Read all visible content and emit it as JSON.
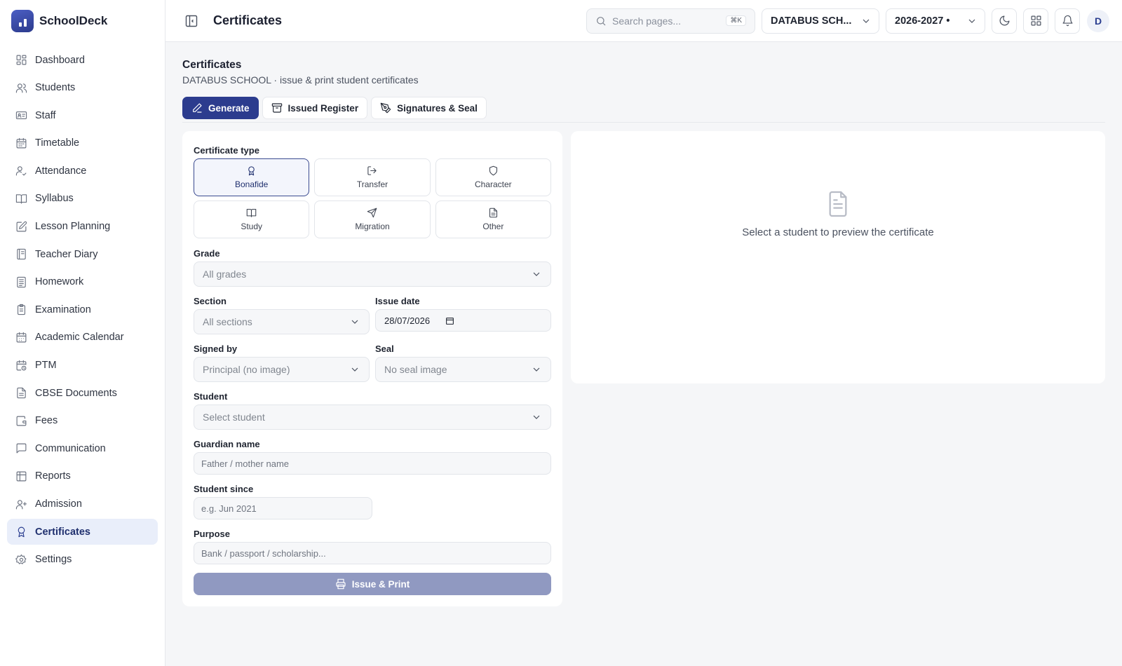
{
  "app": {
    "name": "SchoolDeck"
  },
  "sidebar": {
    "items": [
      {
        "label": "Dashboard",
        "icon": "dashboard-icon"
      },
      {
        "label": "Students",
        "icon": "users-icon"
      },
      {
        "label": "Staff",
        "icon": "id-card-icon"
      },
      {
        "label": "Timetable",
        "icon": "calendar-icon"
      },
      {
        "label": "Attendance",
        "icon": "user-check-icon"
      },
      {
        "label": "Syllabus",
        "icon": "book-open-icon"
      },
      {
        "label": "Lesson Planning",
        "icon": "edit-icon"
      },
      {
        "label": "Teacher Diary",
        "icon": "notebook-icon"
      },
      {
        "label": "Homework",
        "icon": "file-list-icon"
      },
      {
        "label": "Examination",
        "icon": "clipboard-icon"
      },
      {
        "label": "Academic Calendar",
        "icon": "calendar-days-icon"
      },
      {
        "label": "PTM",
        "icon": "calendar-clock-icon"
      },
      {
        "label": "CBSE Documents",
        "icon": "document-icon"
      },
      {
        "label": "Fees",
        "icon": "wallet-icon"
      },
      {
        "label": "Communication",
        "icon": "message-icon"
      },
      {
        "label": "Reports",
        "icon": "table-icon"
      },
      {
        "label": "Admission",
        "icon": "user-plus-icon"
      },
      {
        "label": "Certificates",
        "icon": "award-icon",
        "active": true
      },
      {
        "label": "Settings",
        "icon": "gear-icon"
      }
    ]
  },
  "header": {
    "title": "Certificates",
    "search_placeholder": "Search pages...",
    "search_shortcut": "⌘K",
    "school_select": "DATABUS SCH...",
    "year_select": "2026-2027 •",
    "avatar_initial": "D"
  },
  "page": {
    "title": "Certificates",
    "subtitle": "DATABUS SCHOOL · issue & print student certificates",
    "tabs": [
      {
        "label": "Generate",
        "active": true
      },
      {
        "label": "Issued Register"
      },
      {
        "label": "Signatures & Seal"
      }
    ]
  },
  "form": {
    "type_label": "Certificate type",
    "types": [
      {
        "label": "Bonafide",
        "active": true
      },
      {
        "label": "Transfer"
      },
      {
        "label": "Character"
      },
      {
        "label": "Study"
      },
      {
        "label": "Migration"
      },
      {
        "label": "Other"
      }
    ],
    "grade_label": "Grade",
    "grade_value": "All grades",
    "section_label": "Section",
    "section_value": "All sections",
    "issue_date_label": "Issue date",
    "issue_date_value": "28/07/2026",
    "signed_by_label": "Signed by",
    "signed_by_value": "Principal (no image)",
    "seal_label": "Seal",
    "seal_value": "No seal image",
    "student_label": "Student",
    "student_value": "Select student",
    "guardian_label": "Guardian name",
    "guardian_placeholder": "Father / mother name",
    "since_label": "Student since",
    "since_placeholder": "e.g. Jun 2021",
    "purpose_label": "Purpose",
    "purpose_placeholder": "Bank / passport / scholarship...",
    "submit_label": "Issue & Print"
  },
  "preview": {
    "empty_text": "Select a student to preview the certificate"
  },
  "colors": {
    "accent": "#2c3c8e",
    "active_bg": "#e9eefa",
    "disabled_button": "#9099c1"
  }
}
